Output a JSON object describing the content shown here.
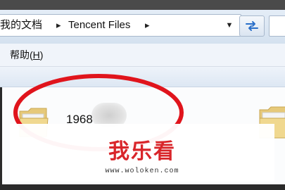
{
  "address_bar": {
    "crumbs": [
      "我的文档",
      "Tencent Files"
    ],
    "separator": "▸",
    "dropdown_icon": "chevron-down-icon",
    "refresh_icon": "refresh-icon"
  },
  "menu": {
    "help_label": "帮助",
    "help_accel": "H"
  },
  "content": {
    "item_name": "1968"
  },
  "watermark": {
    "title": "我乐看",
    "url": "www.woloken.com"
  },
  "colors": {
    "accent_red": "#e0141c",
    "watermark_red": "#d9252a",
    "chrome_blue": "#dde7f3"
  }
}
